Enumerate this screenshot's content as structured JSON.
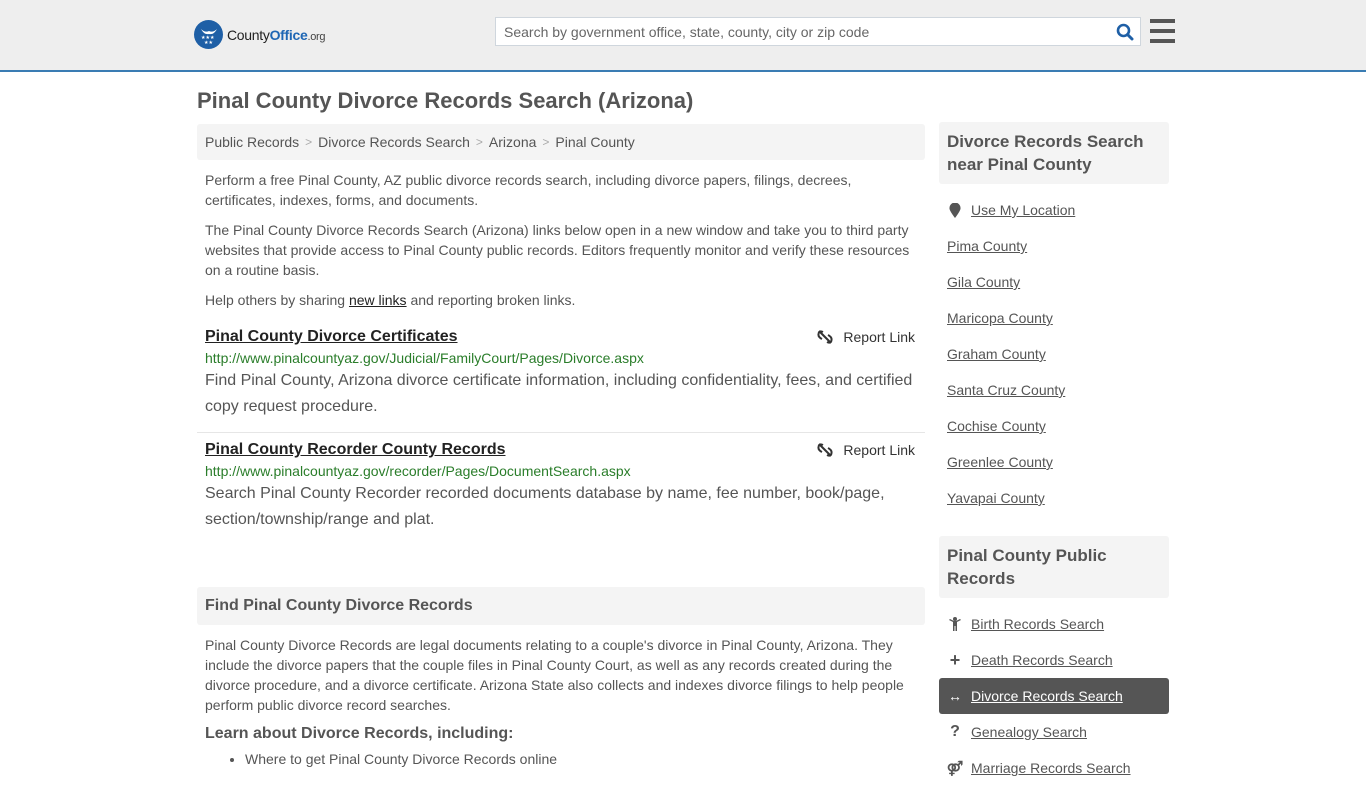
{
  "header": {
    "logo": {
      "name_part1": "County",
      "name_part2": "Office",
      "tld": ".org"
    },
    "search": {
      "placeholder": "Search by government office, state, county, city or zip code",
      "value": ""
    },
    "icons": {
      "search": "search-icon",
      "menu": "hamburger-menu-icon"
    }
  },
  "page": {
    "title": "Pinal County Divorce Records Search (Arizona)"
  },
  "breadcrumb": [
    "Public Records",
    "Divorce Records Search",
    "Arizona",
    "Pinal County"
  ],
  "intro": {
    "p1": "Perform a free Pinal County, AZ public divorce records search, including divorce papers, filings, decrees, certificates, indexes, forms, and documents.",
    "p2": "The Pinal County Divorce Records Search (Arizona) links below open in a new window and take you to third party websites that provide access to Pinal County public records. Editors frequently monitor and verify these resources on a routine basis.",
    "p3_before": "Help others by sharing ",
    "p3_link": "new links",
    "p3_after": " and reporting broken links."
  },
  "results": [
    {
      "title": "Pinal County Divorce Certificates",
      "url": "http://www.pinalcountyaz.gov/Judicial/FamilyCourt/Pages/Divorce.aspx",
      "description": "Find Pinal County, Arizona divorce certificate information, including confidentiality, fees, and certified copy request procedure.",
      "report_label": "Report Link"
    },
    {
      "title": "Pinal County Recorder County Records",
      "url": "http://www.pinalcountyaz.gov/recorder/Pages/DocumentSearch.aspx",
      "description": "Search Pinal County Recorder recorded documents database by name, fee number, book/page, section/township/range and plat.",
      "report_label": "Report Link"
    }
  ],
  "find_section": {
    "heading": "Find Pinal County Divorce Records",
    "body": "Pinal County Divorce Records are legal documents relating to a couple's divorce in Pinal County, Arizona. They include the divorce papers that the couple files in Pinal County Court, as well as any records created during the divorce procedure, and a divorce certificate. Arizona State also collects and indexes divorce filings to help people perform public divorce record searches.",
    "learn_heading": "Learn about Divorce Records, including:",
    "learn_items": [
      "Where to get Pinal County Divorce Records online"
    ]
  },
  "sidebar": {
    "nearby": {
      "heading": "Divorce Records Search near Pinal County",
      "use_location": "Use My Location",
      "counties": [
        "Pima County",
        "Gila County",
        "Maricopa County",
        "Graham County",
        "Santa Cruz County",
        "Cochise County",
        "Greenlee County",
        "Yavapai County"
      ]
    },
    "public_records": {
      "heading": "Pinal County Public Records",
      "items": [
        {
          "label": "Birth Records Search",
          "icon": "child-icon",
          "active": false
        },
        {
          "label": "Death Records Search",
          "icon": "plus-icon",
          "active": false
        },
        {
          "label": "Divorce Records Search",
          "icon": "arrows-horizontal-icon",
          "active": true
        },
        {
          "label": "Genealogy Search",
          "icon": "question-icon",
          "active": false
        },
        {
          "label": "Marriage Records Search",
          "icon": "marriage-icon",
          "active": false
        }
      ]
    }
  },
  "colors": {
    "accent": "#3a7cb3",
    "brand": "#1e5fa6",
    "url_green": "#2a7d2a",
    "active_bg": "#555555"
  }
}
